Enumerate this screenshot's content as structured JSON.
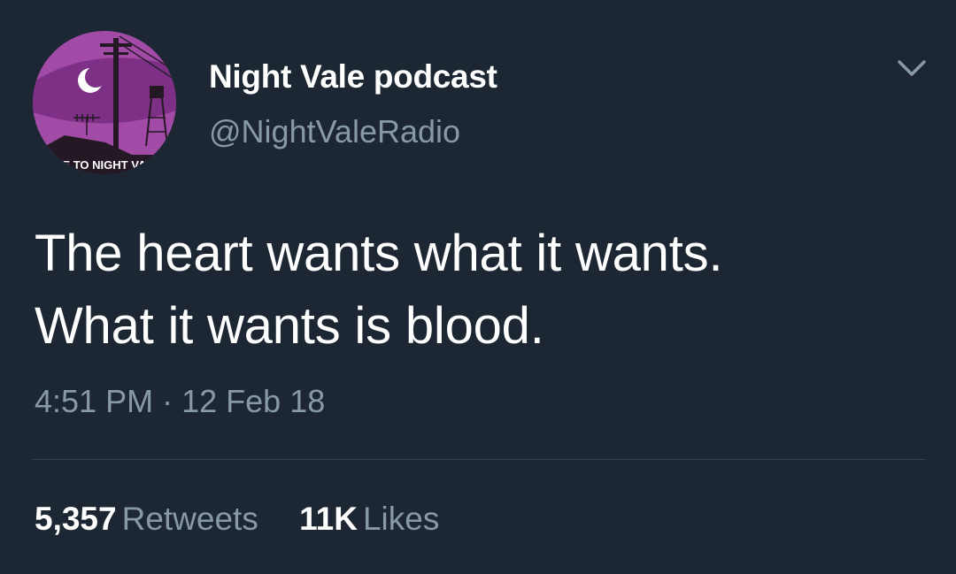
{
  "author": {
    "display_name": "Night Vale podcast",
    "handle": "@NightValeRadio",
    "avatar_banner_text": "COME TO NIGHT VALE"
  },
  "tweet": {
    "lines": [
      "The heart wants what it wants.",
      "What it wants is blood."
    ],
    "time": "4:51 PM",
    "separator": "·",
    "date": "12 Feb 18"
  },
  "stats": {
    "retweets_count": "5,357",
    "retweets_label": "Retweets",
    "likes_count": "11K",
    "likes_label": "Likes"
  },
  "icons": {
    "menu": "chevron-down-icon"
  },
  "colors": {
    "background": "#1c2733",
    "primary_text": "#ffffff",
    "secondary_text": "#8899a6",
    "divider": "#38444d",
    "avatar_purple": "#a24ba6"
  }
}
